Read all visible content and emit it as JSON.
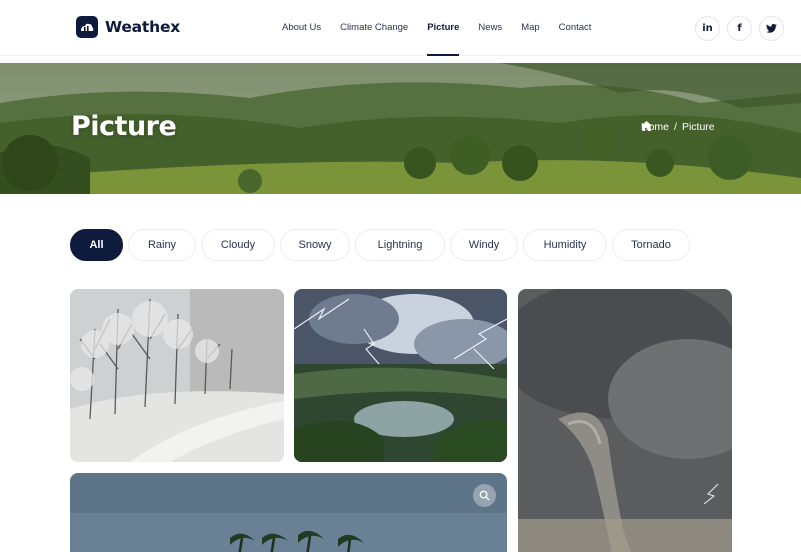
{
  "brand": {
    "name": "Weathex"
  },
  "nav": {
    "items": [
      {
        "label": "About Us"
      },
      {
        "label": "Climate Change"
      },
      {
        "label": "Picture"
      },
      {
        "label": "News"
      },
      {
        "label": "Map"
      },
      {
        "label": "Contact"
      }
    ],
    "active": "Picture"
  },
  "social": [
    {
      "label": "in",
      "icon": "linkedin-icon"
    },
    {
      "label": "f",
      "icon": "facebook-icon"
    },
    {
      "label": "",
      "icon": "twitter-icon"
    }
  ],
  "hero": {
    "title": "Picture",
    "breadcrumb": {
      "home": "Home",
      "separator": "/",
      "current": "Picture"
    }
  },
  "filters": [
    "All",
    "Rainy",
    "Cloudy",
    "Snowy",
    "Lightning",
    "Windy",
    "Humidity",
    "Tornado"
  ],
  "active_filter": "All",
  "gallery": [
    {
      "subject": "snowy forest path",
      "icon": "snow-photo"
    },
    {
      "subject": "lightning over lake",
      "icon": "lightning-photo"
    },
    {
      "subject": "tornado funnel",
      "icon": "tornado-photo"
    },
    {
      "subject": "windy palm trees",
      "icon": "windy-photo",
      "zoom_icon": "search-icon"
    }
  ],
  "colors": {
    "primary": "#0f1b3d",
    "chip_border": "#eceef2",
    "background": "#ffffff"
  }
}
